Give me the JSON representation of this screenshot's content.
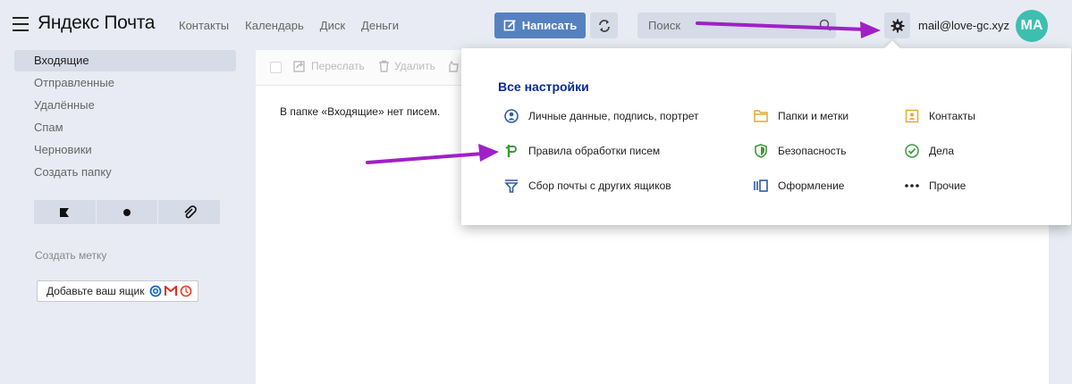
{
  "header": {
    "logo": "Яндекс Почта",
    "nav": [
      "Контакты",
      "Календарь",
      "Диск",
      "Деньги"
    ],
    "compose_label": "Написать",
    "search_placeholder": "Поиск",
    "account_email": "mail@love-gc.xyz",
    "avatar_initials": "MA"
  },
  "sidebar": {
    "folders": [
      "Входящие",
      "Отправленные",
      "Удалённые",
      "Спам",
      "Черновики",
      "Создать папку"
    ],
    "active_folder_index": 0,
    "filters": [
      "flag-icon",
      "dot-icon",
      "paperclip-icon"
    ],
    "create_label": "Создать метку",
    "add_mailbox_label": "Добавьте ваш ящик"
  },
  "main": {
    "toolbar": {
      "forward": "Переслать",
      "delete": "Удалить"
    },
    "empty_message": "В папке «Входящие» нет писем."
  },
  "settings_menu": {
    "title": "Все настройки",
    "items": [
      {
        "label": "Личные данные, подпись, портрет",
        "icon": "person-icon"
      },
      {
        "label": "Папки и метки",
        "icon": "folder-icon"
      },
      {
        "label": "Контакты",
        "icon": "contacts-icon"
      },
      {
        "label": "Правила обработки писем",
        "icon": "rules-icon"
      },
      {
        "label": "Безопасность",
        "icon": "shield-icon"
      },
      {
        "label": "Дела",
        "icon": "check-circle-icon"
      },
      {
        "label": "Сбор почты с других ящиков",
        "icon": "funnel-icon"
      },
      {
        "label": "Оформление",
        "icon": "theme-icon"
      },
      {
        "label": "Прочие",
        "icon": "more-icon"
      }
    ]
  },
  "colors": {
    "background": "#e8ebf3",
    "accent_blue": "#5581c0",
    "avatar": "#3dbfb0",
    "menu_title": "#0b2a96",
    "annotation_arrow": "#a020c8"
  }
}
